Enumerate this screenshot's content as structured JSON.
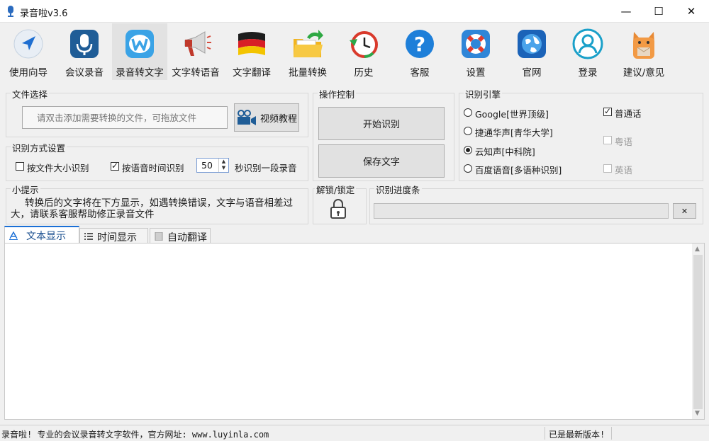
{
  "window": {
    "title": "录音啦v3.6",
    "min_icon": "—",
    "max_icon": "☐",
    "close_icon": "✕"
  },
  "toolbar": {
    "items": [
      {
        "label": "使用向导",
        "icon": "navigation-arrow-icon"
      },
      {
        "label": "会议录音",
        "icon": "microphone-icon"
      },
      {
        "label": "录音转文字",
        "icon": "w-logo-icon"
      },
      {
        "label": "文字转语音",
        "icon": "megaphone-icon"
      },
      {
        "label": "文字翻译",
        "icon": "german-flag-icon"
      },
      {
        "label": "批量转换",
        "icon": "folder-arrow-icon"
      },
      {
        "label": "历史",
        "icon": "history-clock-icon"
      },
      {
        "label": "客服",
        "icon": "question-icon"
      },
      {
        "label": "设置",
        "icon": "lifebuoy-icon"
      },
      {
        "label": "官网",
        "icon": "globe-icon"
      },
      {
        "label": "登录",
        "icon": "user-icon"
      },
      {
        "label": "建议/意见",
        "icon": "cat-mailbox-icon"
      }
    ]
  },
  "file_select": {
    "title": "文件选择",
    "placeholder": "请双击添加需要转换的文件，可拖放文件",
    "video_button": "视频教程"
  },
  "mode": {
    "title": "识别方式设置",
    "by_size": "按文件大小识别",
    "by_time": "按语音时间识别",
    "seconds": "50",
    "suffix": "秒识别一段录音"
  },
  "ops": {
    "title": "操作控制",
    "start": "开始识别",
    "save": "保存文字"
  },
  "engine": {
    "title": "识别引擎",
    "options": [
      "Google[世界顶级]",
      "捷通华声[青华大学]",
      "云知声[中科院]",
      "百度语音[多语种识别]"
    ],
    "selected_index": 2,
    "langs": [
      "普通话",
      "粤语",
      "英语"
    ]
  },
  "tips": {
    "title": "小提示",
    "text": "转换后的文字将在下方显示，如遇转换错误，文字与语音相差过大，请联系客服帮助修正录音文件"
  },
  "lock": {
    "title": "解锁/锁定"
  },
  "progress": {
    "title": "识别进度条",
    "value": 0,
    "clear_icon": "✕"
  },
  "tabs": [
    "文本显示",
    "时间显示",
    "自动翻译"
  ],
  "status": {
    "left": "录音啦! 专业的会议录音转文字软件，官方网址: www.luyinla.com",
    "right": "已是最新版本!"
  },
  "colors": {
    "accent": "#1a6fd6",
    "text": "#1a1a1a",
    "disabled": "#9a9a9a"
  }
}
